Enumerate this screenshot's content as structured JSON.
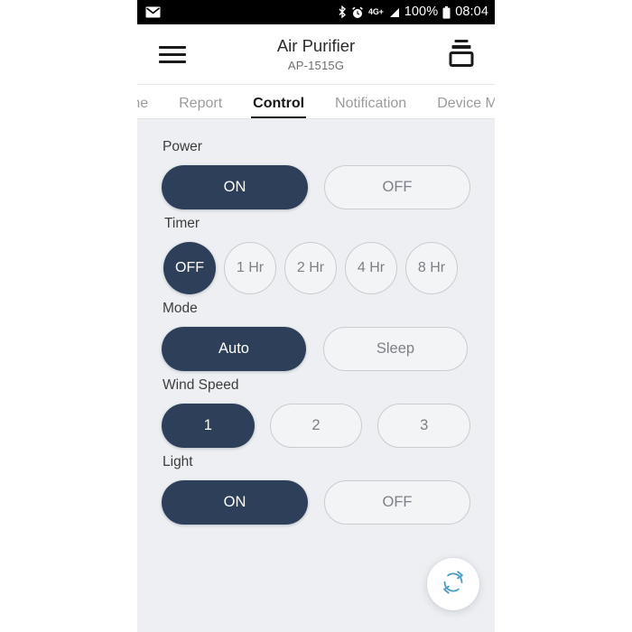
{
  "statusbar": {
    "mail_icon": "envelope-icon",
    "bluetooth_icon": "bluetooth-icon",
    "alarm_icon": "alarm-clock-icon",
    "network_label": "4G+",
    "signal_icon": "signal-bars-icon",
    "battery_percent": "100%",
    "battery_icon": "battery-full-icon",
    "time": "08:04"
  },
  "appbar": {
    "menu_icon": "hamburger-menu-icon",
    "title": "Air Purifier",
    "subtitle": "AP-1515G",
    "right_icon": "device-stack-icon"
  },
  "tabs": [
    {
      "label": "ome",
      "active": false
    },
    {
      "label": "Report",
      "active": false
    },
    {
      "label": "Control",
      "active": true
    },
    {
      "label": "Notification",
      "active": false
    },
    {
      "label": "Device M",
      "active": false
    }
  ],
  "controls": {
    "power": {
      "label": "Power",
      "options": [
        {
          "label": "ON",
          "selected": true
        },
        {
          "label": "OFF",
          "selected": false
        }
      ]
    },
    "timer": {
      "label": "Timer",
      "options": [
        {
          "label": "OFF",
          "selected": true
        },
        {
          "label": "1 Hr",
          "selected": false
        },
        {
          "label": "2 Hr",
          "selected": false
        },
        {
          "label": "4 Hr",
          "selected": false
        },
        {
          "label": "8 Hr",
          "selected": false
        }
      ]
    },
    "mode": {
      "label": "Mode",
      "options": [
        {
          "label": "Auto",
          "selected": true
        },
        {
          "label": "Sleep",
          "selected": false
        }
      ]
    },
    "wind_speed": {
      "label": "Wind Speed",
      "options": [
        {
          "label": "1",
          "selected": true
        },
        {
          "label": "2",
          "selected": false
        },
        {
          "label": "3",
          "selected": false
        }
      ]
    },
    "light": {
      "label": "Light",
      "options": [
        {
          "label": "ON",
          "selected": true
        },
        {
          "label": "OFF",
          "selected": false
        }
      ]
    }
  },
  "fab": {
    "icon": "refresh-icon"
  },
  "colors": {
    "selected_bg": "#2e4059",
    "page_bg": "#edeff2",
    "unselected_border": "#c9ccd1",
    "accent_refresh": "#4a9ec4"
  }
}
